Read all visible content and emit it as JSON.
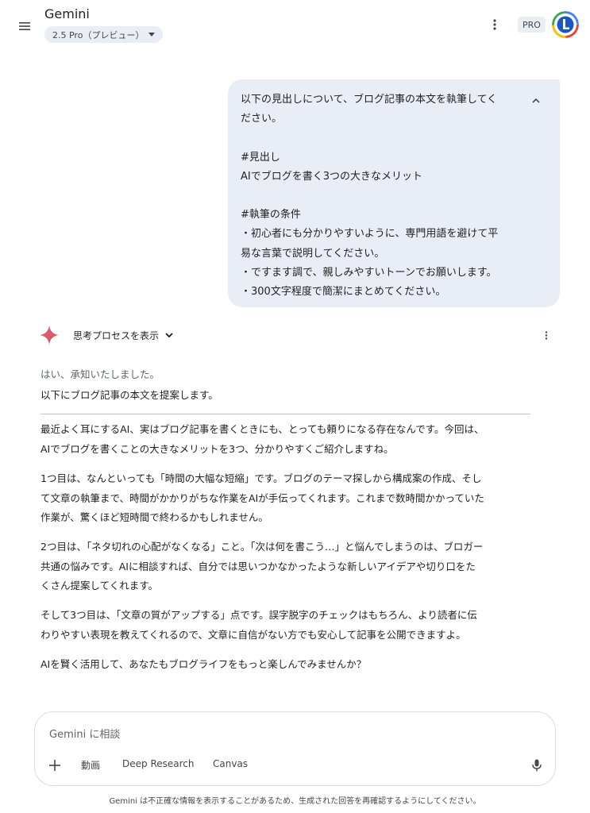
{
  "header": {
    "title": "Gemini",
    "model": "2.5 Pro（プレビュー）",
    "badge": "PRO"
  },
  "user_message": {
    "lines": [
      "以下の見出しについて、ブログ記事の本文を執筆してく",
      "ださい。",
      "",
      "#見出し",
      "AIでブログを書く3つの大きなメリット",
      "",
      "#執筆の条件",
      "・初心者にも分かりやすいように、専門用語を避けて平",
      "易な言葉で説明してください。",
      "・ですます調で、親しみやすいトーンでお願いします。",
      "・300文字程度で簡潔にまとめてください。"
    ]
  },
  "thinking": {
    "label": "思考プロセスを表示"
  },
  "response": {
    "intro1": "はい、承知いたしました。",
    "intro2": "以下にブログ記事の本文を提案します。",
    "paragraphs": [
      [
        "最近よく耳にするAI、実はブログ記事を書くときにも、とっても頼りになる存在なんです。今回は、",
        "AIでブログを書くことの大きなメリットを3つ、分かりやすくご紹介しますね。"
      ],
      [
        "1つ目は、なんといっても「時間の大幅な短縮」です。ブログのテーマ探しから構成案の作成、そし",
        "て文章の執筆まで、時間がかかりがちな作業をAIが手伝ってくれます。これまで数時間かかっていた",
        "作業が、驚くほど短時間で終わるかもしれません。"
      ],
      [
        "2つ目は、「ネタ切れの心配がなくなる」こと。「次は何を書こう…」と悩んでしまうのは、ブロガー",
        "共通の悩みです。AIに相談すれば、自分では思いつかなかったような新しいアイデアや切り口をた",
        "くさん提案してくれます。"
      ],
      [
        "そして3つ目は、「文章の質がアップする」点です。誤字脱字のチェックはもちろん、より読者に伝",
        "わりやすい表現を教えてくれるので、文章に自信がない方でも安心して記事を公開できますよ。"
      ],
      [
        "AIを賢く活用して、あなたもブログライフをもっと楽しんでみませんか？"
      ]
    ]
  },
  "input": {
    "placeholder": "Gemini に相談",
    "tools": [
      "動画",
      "Deep Research",
      "Canvas"
    ]
  },
  "footer": {
    "disclaimer": "Gemini は不正確な情報を表示することがあるため、生成された回答を再確認するようにしてください。"
  },
  "colors": {
    "bubble": "#e9eef6",
    "spark": "#d95c6c"
  }
}
